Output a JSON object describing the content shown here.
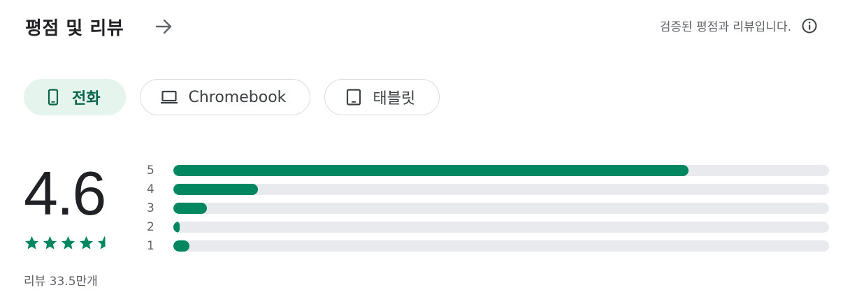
{
  "header": {
    "title": "평점 및 리뷰",
    "verified_text": "검증된 평점과 리뷰입니다."
  },
  "device_tabs": [
    {
      "label": "전화",
      "icon": "phone-icon",
      "selected": true
    },
    {
      "label": "Chromebook",
      "icon": "laptop-icon",
      "selected": false
    },
    {
      "label": "태블릿",
      "icon": "tablet-icon",
      "selected": false
    }
  ],
  "rating": {
    "score": "4.6",
    "stars": 4.6,
    "review_count": "리뷰 33.5만개"
  },
  "distribution": [
    {
      "label": "5",
      "fraction": 0.786
    },
    {
      "label": "4",
      "fraction": 0.129
    },
    {
      "label": "3",
      "fraction": 0.051
    },
    {
      "label": "2",
      "fraction": 0.01
    },
    {
      "label": "1",
      "fraction": 0.024
    }
  ],
  "colors": {
    "accent": "#01875f",
    "accent_text": "#056449",
    "chip_selected_bg": "#e6f4ee",
    "track": "#e8eaed"
  }
}
